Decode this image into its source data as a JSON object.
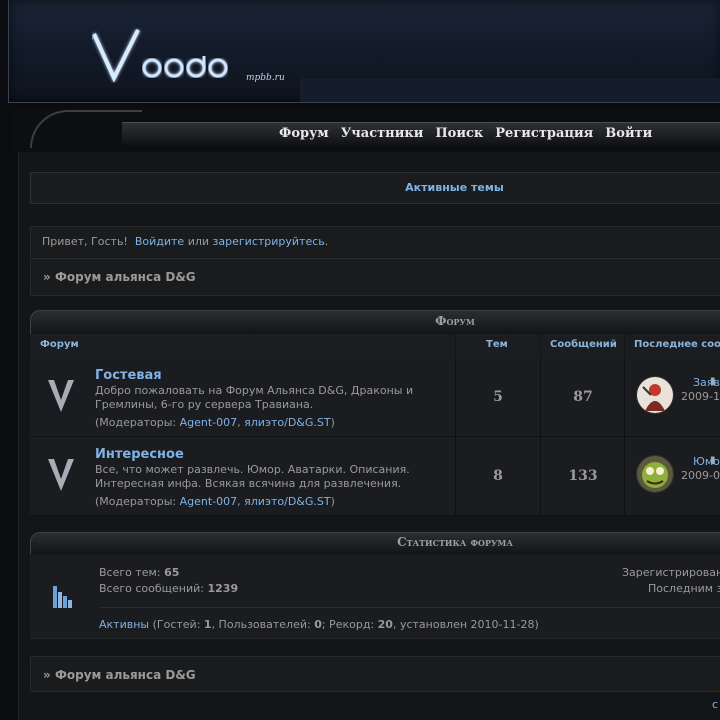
{
  "header": {
    "logo_text": "Voodoo",
    "logo_sub": "mpbb.ru"
  },
  "nav": {
    "items": [
      "Форум",
      "Участники",
      "Поиск",
      "Регистрация",
      "Войти"
    ]
  },
  "active_topics": "Активные темы",
  "greeting": {
    "prefix": "Привет, Гость!",
    "login_link": "Войдите",
    "or": "или",
    "register_link": "зарегистрируйтесь",
    "dot": "."
  },
  "breadcrumb": {
    "arrow": "»",
    "label": "Форум альянса D&G"
  },
  "category": {
    "title": "Форум",
    "columns": {
      "forum": "Форум",
      "topics": "Тем",
      "posts": "Сообщений",
      "last_post": "Последнее соо"
    },
    "forums": [
      {
        "name": "Гостевая",
        "desc": "Добро пожаловать на Форум Альянса D&G, Драконы и Гремлины, 6-го ру сервера Травиана.",
        "mods_label": "(Модераторы:",
        "mod1": "Agent-007",
        "mod2": "ялиэто/D&G.ST",
        "mods_end": ")",
        "topics": "5",
        "posts": "87",
        "last_link": "Заяв",
        "last_date": "2009-1"
      },
      {
        "name": "Интересное",
        "desc": "Все, что может развлечь. Юмор. Аватарки. Описания. Интересная инфа. Всякая всячина для развлечения.",
        "mods_label": "(Модераторы:",
        "mod1": "Agent-007",
        "mod2": "ялиэто/D&G.ST",
        "mods_end": ")",
        "topics": "8",
        "posts": "133",
        "last_link": "Юмо",
        "last_date": "2009-0"
      }
    ]
  },
  "stats": {
    "title": "Статистика форума",
    "total_topics_label": "Всего тем:",
    "total_topics": "65",
    "total_posts_label": "Всего сообщений:",
    "total_posts": "1239",
    "registered_label": "Зарегистрирован",
    "last_label": "Последним з",
    "active_link": "Активны",
    "active_guests_label": "(Гостей:",
    "guests": "1",
    "users_label": ", Пользователей:",
    "users": "0",
    "record_label": "; Рекорд:",
    "record": "20",
    "record_date": ", установлен 2010-11-28)"
  },
  "breadcrumb2": {
    "arrow": "»",
    "label": "Форум альянса D&G"
  },
  "bottom_link": "с"
}
